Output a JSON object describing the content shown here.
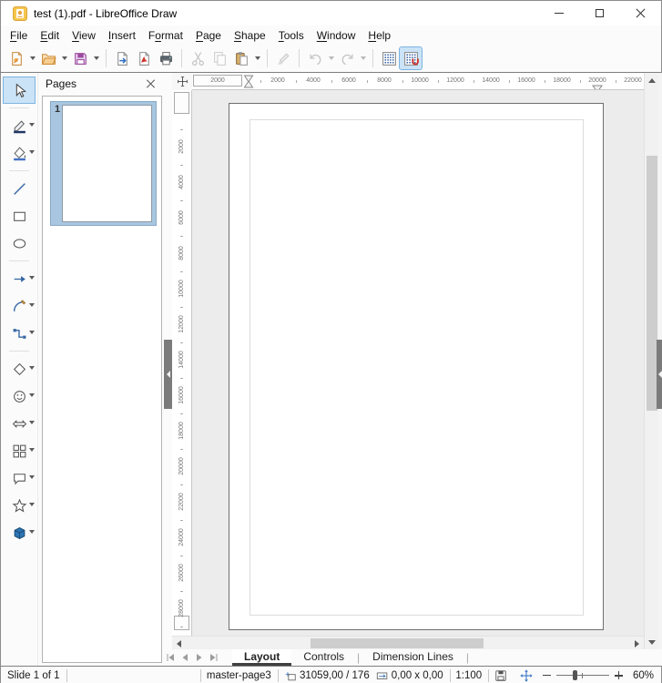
{
  "window": {
    "title": "test (1).pdf - LibreOffice Draw",
    "controls": [
      {
        "name": "minimize"
      },
      {
        "name": "maximize"
      },
      {
        "name": "close"
      }
    ]
  },
  "menu": {
    "items": [
      {
        "label": "File",
        "mnemonic_index": 0
      },
      {
        "label": "Edit",
        "mnemonic_index": 0
      },
      {
        "label": "View",
        "mnemonic_index": 0
      },
      {
        "label": "Insert",
        "mnemonic_index": 0
      },
      {
        "label": "Format",
        "mnemonic_index": 1
      },
      {
        "label": "Page",
        "mnemonic_index": 0
      },
      {
        "label": "Shape",
        "mnemonic_index": 0
      },
      {
        "label": "Tools",
        "mnemonic_index": 0
      },
      {
        "label": "Window",
        "mnemonic_index": 0
      },
      {
        "label": "Help",
        "mnemonic_index": 0
      }
    ]
  },
  "toolbar": {
    "buttons": [
      {
        "name": "new-document",
        "dropdown": true
      },
      {
        "name": "open",
        "dropdown": true
      },
      {
        "name": "save",
        "dropdown": true
      },
      {
        "separator": true
      },
      {
        "name": "export"
      },
      {
        "name": "export-as-pdf"
      },
      {
        "name": "print"
      },
      {
        "separator": true
      },
      {
        "name": "cut",
        "disabled": true
      },
      {
        "name": "copy",
        "disabled": true
      },
      {
        "name": "paste",
        "dropdown": true
      },
      {
        "separator": true
      },
      {
        "name": "clone-formatting",
        "disabled": true
      },
      {
        "separator": true
      },
      {
        "name": "undo",
        "disabled": true,
        "dropdown": true
      },
      {
        "name": "redo",
        "disabled": true,
        "dropdown": true
      },
      {
        "separator": true
      },
      {
        "name": "display-grid"
      },
      {
        "name": "snap-to-grid",
        "active": true
      }
    ]
  },
  "drawing_tools": {
    "items": [
      {
        "name": "select",
        "active": true
      },
      {
        "separator": true
      },
      {
        "name": "line-color",
        "dropdown": true
      },
      {
        "name": "fill-color",
        "dropdown": true
      },
      {
        "separator": true
      },
      {
        "name": "insert-line"
      },
      {
        "name": "rectangle"
      },
      {
        "name": "ellipse"
      },
      {
        "separator": true
      },
      {
        "name": "lines-and-arrows",
        "dropdown": true
      },
      {
        "name": "curves-and-polygons",
        "dropdown": true
      },
      {
        "name": "connectors",
        "dropdown": true
      },
      {
        "separator": true
      },
      {
        "name": "basic-shapes",
        "dropdown": true
      },
      {
        "name": "symbol-shapes",
        "dropdown": true
      },
      {
        "name": "block-arrows",
        "dropdown": true
      },
      {
        "name": "flowchart",
        "dropdown": true
      },
      {
        "name": "callout-shapes",
        "dropdown": true
      },
      {
        "name": "stars-and-banners",
        "dropdown": true
      },
      {
        "name": "3d-objects",
        "dropdown": true
      }
    ]
  },
  "pages_panel": {
    "title": "Pages",
    "pages": [
      {
        "number": "1",
        "selected": true
      }
    ]
  },
  "rulers": {
    "unit_note": "ruler numbers shown in document units",
    "horizontal": {
      "margin_label": "2000",
      "labels": [
        "2000",
        "4000",
        "6000",
        "8000",
        "10000",
        "12000",
        "14000",
        "16000",
        "18000",
        "20000",
        "22000"
      ]
    },
    "vertical": {
      "labels": [
        "2000",
        "4000",
        "6000",
        "8000",
        "10000",
        "12000",
        "14000",
        "16000",
        "18000",
        "20000",
        "22000",
        "24000",
        "26000",
        "28000"
      ]
    }
  },
  "tabs": {
    "items": [
      {
        "label": "Layout",
        "active": true
      },
      {
        "label": "Controls",
        "active": false
      },
      {
        "label": "Dimension Lines",
        "active": false
      }
    ]
  },
  "statusbar": {
    "slide_label": "Slide 1 of 1",
    "master_page": "master-page3",
    "cursor_position": "31059,00 / 176",
    "object_size": "0,00 x 0,00",
    "scale": "1:100",
    "zoom_level": "60%"
  },
  "colors": {
    "accent_highlight": "#cbe3f7",
    "accent_border": "#7eb3e0",
    "selection_blue": "#a9c6e0",
    "canvas_bg": "#ececec",
    "tool_blue": "#3465a4",
    "magnet_red": "#d0342c",
    "ruler_text": "#737373"
  }
}
